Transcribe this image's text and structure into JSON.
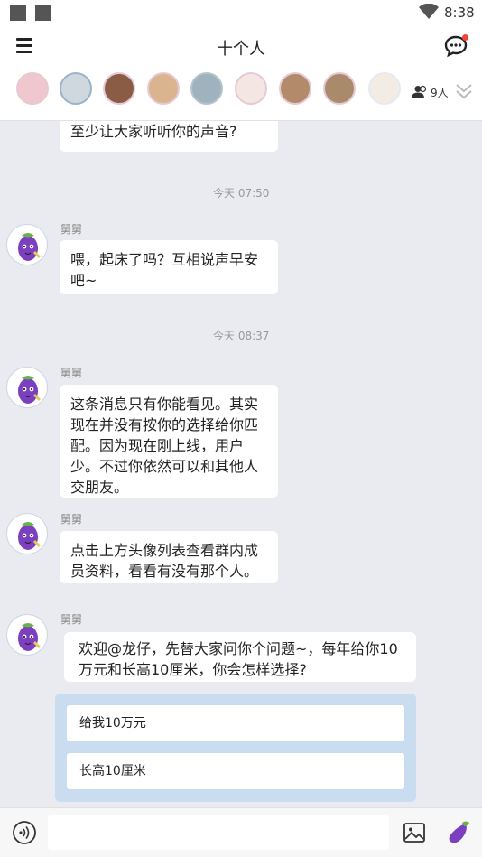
{
  "status_bar": {
    "time": "8:38"
  },
  "header": {
    "title": "十个人"
  },
  "members": {
    "avatars": [
      "member-1",
      "member-2",
      "member-3",
      "member-4",
      "member-5",
      "member-6",
      "member-7",
      "member-8",
      "member-9"
    ],
    "count_label": "9人"
  },
  "messages": [
    {
      "type": "partial",
      "text": "至少让大家听听你的声音?"
    },
    {
      "type": "time",
      "text": "今天 07:50"
    },
    {
      "type": "msg",
      "sender": "舅舅",
      "text": "喂，起床了吗？互相说声早安吧~"
    },
    {
      "type": "time",
      "text": "今天 08:37"
    },
    {
      "type": "msg",
      "sender": "舅舅",
      "text": "这条消息只有你能看见。其实现在并没有按你的选择给你匹配。因为现在刚上线，用户少。不过你依然可以和其他人交朋友。"
    },
    {
      "type": "msg",
      "sender": "舅舅",
      "text": "点击上方头像列表查看群内成员资料，看看有没有那个人。"
    },
    {
      "type": "msg",
      "sender": "舅舅",
      "text": "欢迎@龙仔，先替大家问你个问题~，每年给你10万元和长高10厘米，你会怎样选择?"
    }
  ],
  "options": [
    "给我10万元",
    "长高10厘米"
  ],
  "input": {
    "placeholder": ""
  },
  "icons": {
    "menu": "menu-icon",
    "chat": "chat-bubble-icon",
    "members": "people-icon",
    "expand": "double-chevron-down-icon",
    "voice": "voice-icon",
    "image": "image-icon",
    "emoji": "eggplant-icon",
    "bot": "eggplant-avatar"
  },
  "colors": {
    "accent_blue": "#c9dcf0",
    "notify_red": "#f44336",
    "background": "#e9ebf0"
  }
}
